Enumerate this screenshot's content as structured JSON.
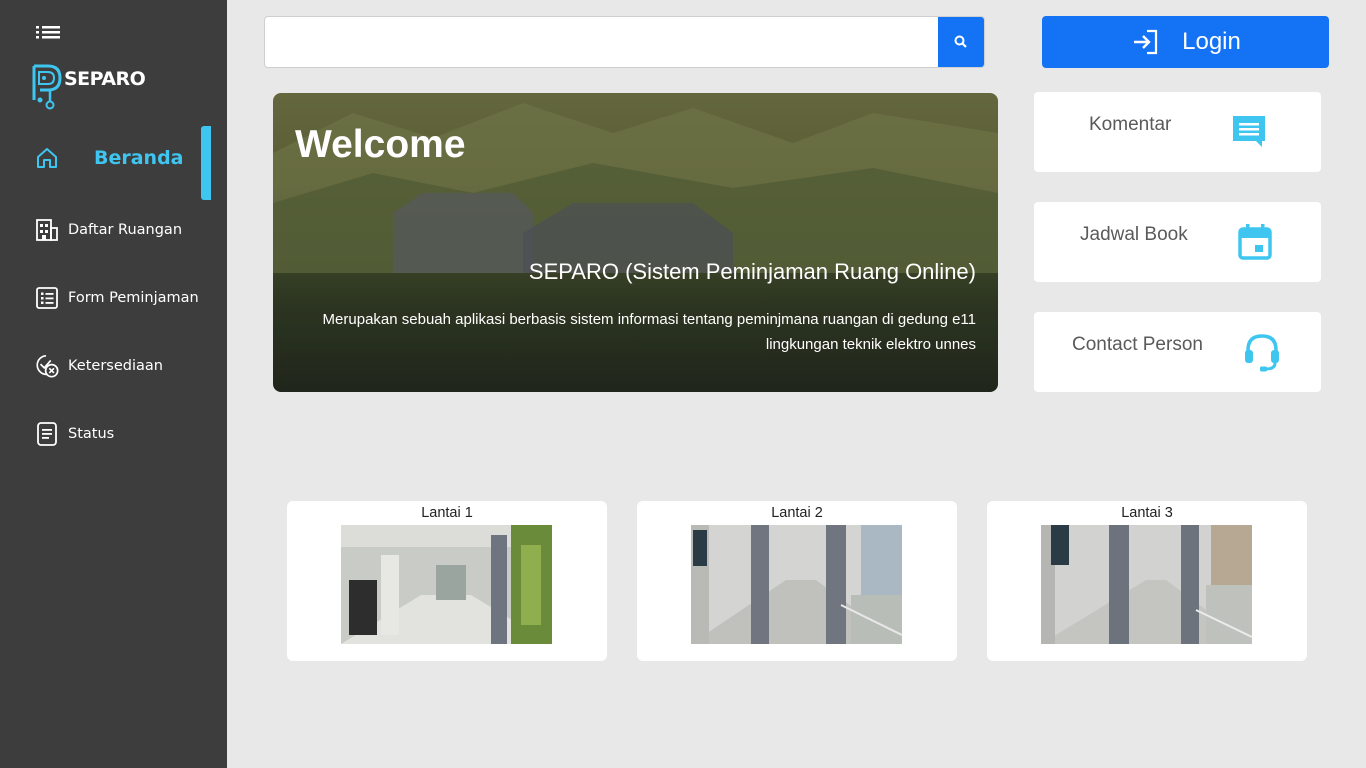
{
  "sidebar": {
    "brand": "SEPARO",
    "items": [
      {
        "label": "Beranda",
        "icon": "home-icon",
        "active": true
      },
      {
        "label": "Daftar Ruangan",
        "icon": "building-icon",
        "active": false
      },
      {
        "label": "Form Peminjaman",
        "icon": "form-list-icon",
        "active": false
      },
      {
        "label": "Ketersediaan",
        "icon": "availability-icon",
        "active": false
      },
      {
        "label": "Status",
        "icon": "document-icon",
        "active": false
      }
    ]
  },
  "search": {
    "value": "",
    "placeholder": ""
  },
  "login": {
    "label": "Login"
  },
  "hero": {
    "title": "Welcome",
    "subtitle": "SEPARO (Sistem Peminjaman Ruang Online)",
    "description": "Merupakan sebuah aplikasi berbasis sistem informasi tentang peminjmana ruangan di gedung e11 lingkungan teknik elektro unnes"
  },
  "cards": [
    {
      "label": "Komentar",
      "icon": "comment-icon"
    },
    {
      "label": "Jadwal Book",
      "icon": "calendar-icon"
    },
    {
      "label": "Contact Person",
      "icon": "headset-icon"
    }
  ],
  "floors": [
    {
      "label": "Lantai 1"
    },
    {
      "label": "Lantai 2"
    },
    {
      "label": "Lantai 3"
    }
  ],
  "colors": {
    "sidebar_bg": "#3d3d3d",
    "accent": "#3ec6f0",
    "primary": "#1473f5",
    "page_bg": "#e8e8e8"
  }
}
